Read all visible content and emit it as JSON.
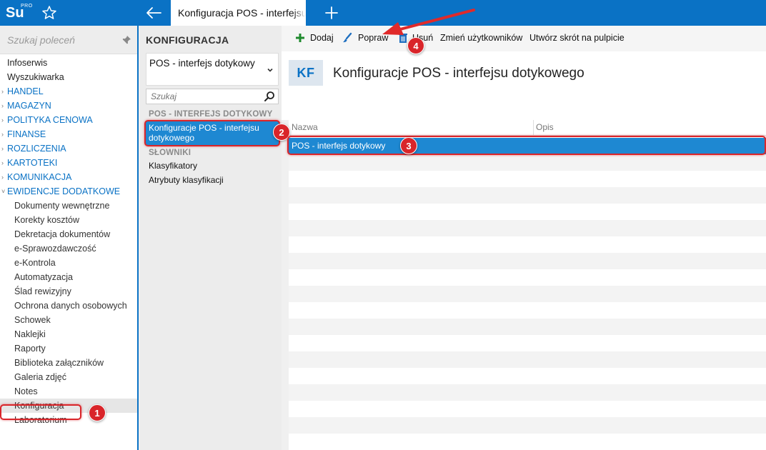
{
  "app": {
    "logo_main": "Su",
    "logo_sup": "PRO",
    "accent": "#0a72c5",
    "icons": {
      "favorite": "star-icon",
      "back": "arrow-left-icon",
      "new_tab": "plus-icon"
    }
  },
  "tabs": [
    {
      "label": "Konfiguracja POS - interfejsu dotykowego",
      "active": true
    }
  ],
  "sidebar": {
    "search_placeholder": "Szukaj poleceń",
    "items": [
      {
        "label": "Infoserwis",
        "kind": "top"
      },
      {
        "label": "Wyszukiwarka",
        "kind": "top"
      },
      {
        "label": "HANDEL",
        "kind": "group"
      },
      {
        "label": "MAGAZYN",
        "kind": "group"
      },
      {
        "label": "POLITYKA CENOWA",
        "kind": "group"
      },
      {
        "label": "FINANSE",
        "kind": "group"
      },
      {
        "label": "ROZLICZENIA",
        "kind": "group"
      },
      {
        "label": "KARTOTEKI",
        "kind": "group"
      },
      {
        "label": "KOMUNIKACJA",
        "kind": "group"
      },
      {
        "label": "EWIDENCJE DODATKOWE",
        "kind": "group",
        "expanded": true
      },
      {
        "label": "Dokumenty wewnętrzne",
        "kind": "sub"
      },
      {
        "label": "Korekty kosztów",
        "kind": "sub"
      },
      {
        "label": "Dekretacja dokumentów",
        "kind": "sub"
      },
      {
        "label": "e-Sprawozdawczość",
        "kind": "sub"
      },
      {
        "label": "e-Kontrola",
        "kind": "sub"
      },
      {
        "label": "Automatyzacja",
        "kind": "sub"
      },
      {
        "label": "Ślad rewizyjny",
        "kind": "sub"
      },
      {
        "label": "Ochrona danych osobowych",
        "kind": "sub"
      },
      {
        "label": "Schowek",
        "kind": "sub"
      },
      {
        "label": "Naklejki",
        "kind": "sub"
      },
      {
        "label": "Raporty",
        "kind": "sub"
      },
      {
        "label": "Biblioteka załączników",
        "kind": "sub"
      },
      {
        "label": "Galeria zdjęć",
        "kind": "sub"
      },
      {
        "label": "Notes",
        "kind": "sub"
      },
      {
        "label": "Konfiguracja",
        "kind": "sub",
        "selected": true
      },
      {
        "label": "Laboratorium",
        "kind": "sub"
      }
    ]
  },
  "middle": {
    "title": "KONFIGURACJA",
    "select_value": "POS - interfejs dotykowy",
    "search_placeholder": "Szukaj",
    "section1": "POS - INTERFEJS DOTYKOWY",
    "item_selected": "Konfiguracje POS - interfejsu dotykowego",
    "section2": "SŁOWNIKI",
    "item2": "Klasyfikatory",
    "item3": "Atrybuty klasyfikacji"
  },
  "toolbar": {
    "add": "Dodaj",
    "edit": "Popraw",
    "delete": "Usuń",
    "change_users": "Zmień użytkowników",
    "shortcut": "Utwórz skrót na pulpicie"
  },
  "content": {
    "badge": "KF",
    "title": "Konfiguracje POS - interfejsu dotykowego",
    "columns": [
      "Nazwa",
      "Opis"
    ],
    "rows": [
      {
        "name": "POS - interfejs dotykowy",
        "desc": ""
      }
    ]
  },
  "annotations": {
    "markers": [
      "1",
      "2",
      "3",
      "4"
    ],
    "color": "#d9252a"
  }
}
